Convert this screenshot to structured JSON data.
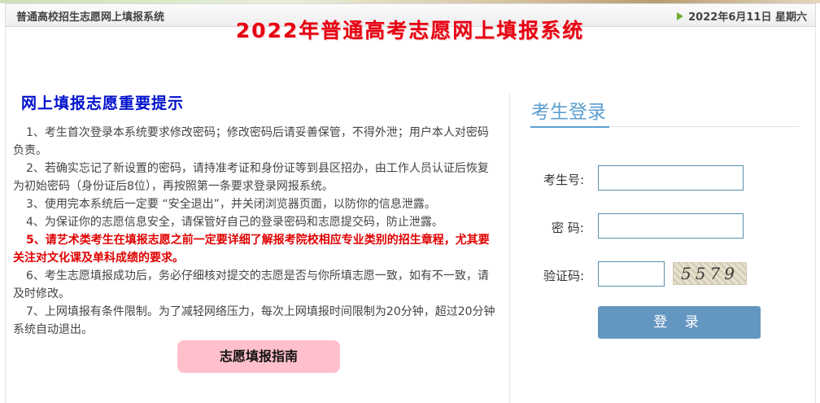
{
  "header": {
    "site_name": "普通高校招生志愿网上填报系统",
    "date": "2022年6月11日 星期六"
  },
  "main": {
    "title": "2022年普通高考志愿网上填报系统"
  },
  "notice": {
    "title": "网上填报志愿重要提示",
    "items": [
      "1、考生首次登录本系统要求修改密码；修改密码后请妥善保管，不得外泄；用户本人对密码负责。",
      "2、若确实忘记了新设置的密码，请持准考证和身份证等到县区招办，由工作人员认证后恢复为初始密码（身份证后8位），再按照第一条要求登录网报系统。",
      "3、使用完本系统后一定要 “安全退出”，并关闭浏览器页面，以防你的信息泄露。",
      "4、为保证你的志愿信息安全，请保管好自己的登录密码和志愿提交码，防止泄露。",
      "5、请艺术类考生在填报志愿之前一定要详细了解报考院校相应专业类别的招生章程，尤其要关注对文化课及单科成绩的要求。",
      "6、考生志愿填报成功后，务必仔细核对提交的志愿是否与你所填志愿一致，如有不一致，请及时修改。",
      "7、上网填报有条件限制。为了减轻网络压力，每次上网填报时间限制为20分钟，超过20分钟系统自动退出。"
    ],
    "guide_button": "志愿填报指南"
  },
  "login": {
    "title": "考生登录",
    "exam_id_label": "考生号:",
    "exam_id_value": "",
    "password_label": "密 码:",
    "password_value": "",
    "captcha_label": "验证码:",
    "captcha_value": "",
    "captcha_image_text": "5579",
    "submit": "登 录"
  },
  "colors": {
    "title_red": "#e60012",
    "notice_blue": "#0010cc",
    "warn_red": "#e00000",
    "login_blue": "#5b9ecf",
    "button_blue": "#6496c2",
    "guide_pink": "#ffc0cb"
  }
}
